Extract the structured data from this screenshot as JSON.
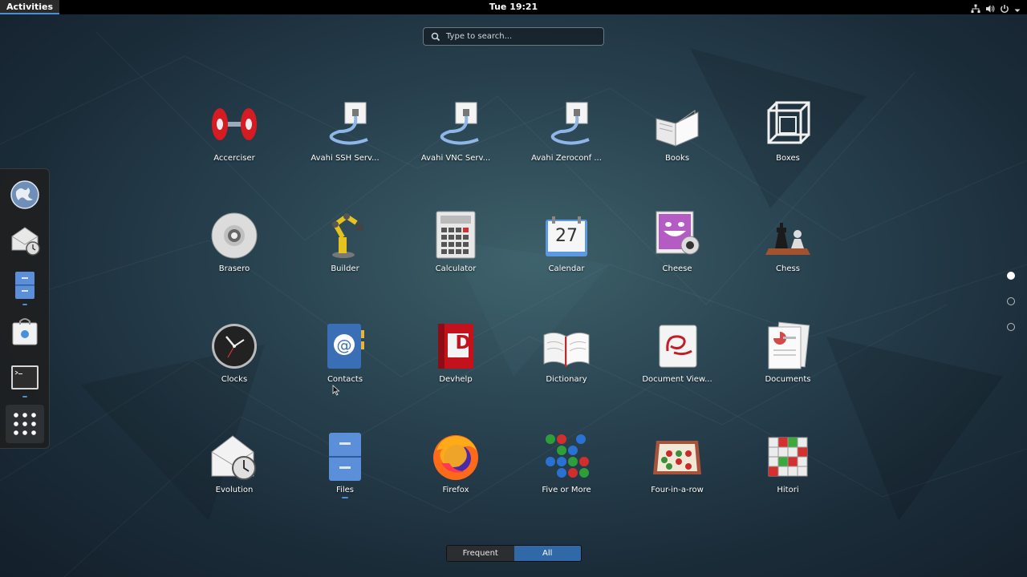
{
  "topbar": {
    "activities_label": "Activities",
    "clock": "Tue 19:21",
    "status_icons": [
      "network-icon",
      "volume-icon",
      "power-icon",
      "chevron-down-icon"
    ]
  },
  "search": {
    "placeholder": "Type to search..."
  },
  "dash": {
    "items": [
      {
        "name": "web-browser",
        "running": false
      },
      {
        "name": "evolution-mail",
        "running": false
      },
      {
        "name": "files",
        "running": true
      },
      {
        "name": "software",
        "running": false
      },
      {
        "name": "terminal",
        "running": true
      },
      {
        "name": "show-applications",
        "running": false
      }
    ]
  },
  "apps": [
    {
      "label": "Accerciser",
      "icon": "accerciser-icon",
      "running": false
    },
    {
      "label": "Avahi SSH Serv...",
      "icon": "avahi-ssh-icon",
      "running": false
    },
    {
      "label": "Avahi VNC Serv...",
      "icon": "avahi-vnc-icon",
      "running": false
    },
    {
      "label": "Avahi Zeroconf ...",
      "icon": "avahi-zeroconf-icon",
      "running": false
    },
    {
      "label": "Books",
      "icon": "books-icon",
      "running": false
    },
    {
      "label": "Boxes",
      "icon": "boxes-icon",
      "running": false
    },
    {
      "label": "Brasero",
      "icon": "brasero-icon",
      "running": false
    },
    {
      "label": "Builder",
      "icon": "builder-icon",
      "running": false
    },
    {
      "label": "Calculator",
      "icon": "calculator-icon",
      "running": false
    },
    {
      "label": "Calendar",
      "icon": "calendar-icon",
      "running": false,
      "day": "27"
    },
    {
      "label": "Cheese",
      "icon": "cheese-icon",
      "running": false
    },
    {
      "label": "Chess",
      "icon": "chess-icon",
      "running": false
    },
    {
      "label": "Clocks",
      "icon": "clocks-icon",
      "running": false
    },
    {
      "label": "Contacts",
      "icon": "contacts-icon",
      "running": false
    },
    {
      "label": "Devhelp",
      "icon": "devhelp-icon",
      "running": false,
      "glyph": "D"
    },
    {
      "label": "Dictionary",
      "icon": "dictionary-icon",
      "running": false
    },
    {
      "label": "Document View...",
      "icon": "document-viewer-icon",
      "running": false
    },
    {
      "label": "Documents",
      "icon": "documents-icon",
      "running": false
    },
    {
      "label": "Evolution",
      "icon": "evolution-icon",
      "running": false
    },
    {
      "label": "Files",
      "icon": "files-icon",
      "running": true
    },
    {
      "label": "Firefox",
      "icon": "firefox-icon",
      "running": false
    },
    {
      "label": "Five or More",
      "icon": "five-or-more-icon",
      "running": false
    },
    {
      "label": "Four-in-a-row",
      "icon": "four-in-a-row-icon",
      "running": false
    },
    {
      "label": "Hitori",
      "icon": "hitori-icon",
      "running": false
    }
  ],
  "pages": {
    "count": 3,
    "current": 1
  },
  "view_toggle": {
    "frequent_label": "Frequent",
    "all_label": "All",
    "selected": "All"
  },
  "colors": {
    "accent": "#3168a8",
    "topbar": "#000000",
    "running_indicator": "#4a90d9"
  }
}
